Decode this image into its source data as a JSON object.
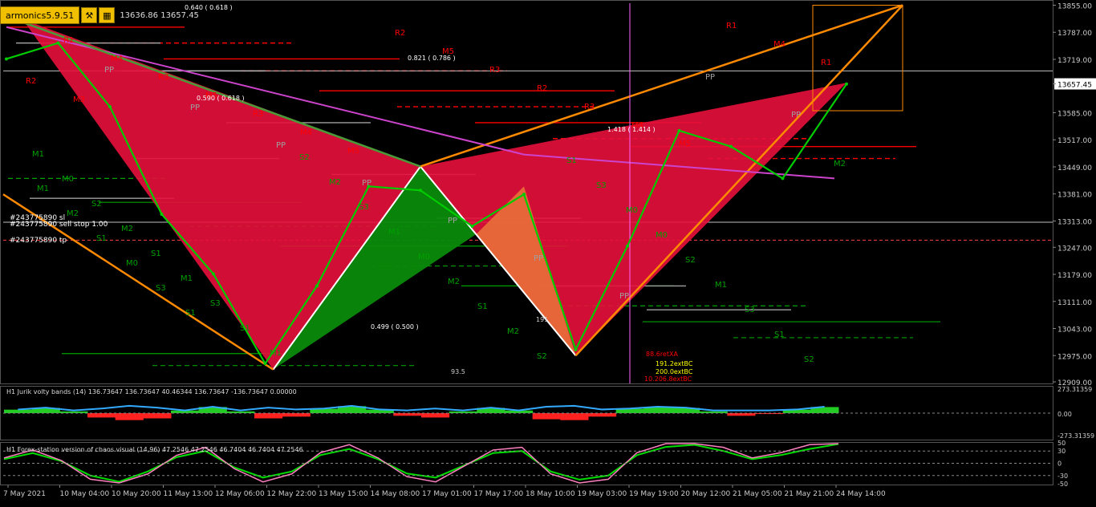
{
  "header": {
    "indicator_title": "armonics5.9.51",
    "ohlc": "13636.86 13657.45"
  },
  "colors": {
    "background": "#000000",
    "candle": "#00cc00",
    "resistance": "#ff0000",
    "support": "#00a000",
    "pivot": "#a0a0a0",
    "harmonic_fill": "#e8103c",
    "orange_trend": "#ff8a00",
    "ma_line": "#cc44cc",
    "jurik_up": "#22cc22",
    "jurik_down": "#ff2020",
    "jurik_band": "#33aaff",
    "chaos_line": "#00dd00",
    "chaos_pink": "#ff80c0",
    "chaos_white": "#e0e0e0"
  },
  "chart_data": [
    {
      "type": "line",
      "title": "",
      "x": [
        "7 May 2021",
        "10 May 04:00",
        "10 May 20:00",
        "11 May 13:00",
        "12 May 06:00",
        "12 May 22:00",
        "13 May 15:00",
        "14 May 08:00",
        "17 May 01:00",
        "17 May 17:00",
        "18 May 10:00",
        "19 May 03:00",
        "19 May 19:00",
        "20 May 12:00",
        "21 May 05:00",
        "21 May 21:00",
        "24 May 14:00"
      ],
      "series": [
        {
          "values": [
            13720,
            13760,
            13600,
            13330,
            13180,
            12955,
            13150,
            13400,
            13390,
            13300,
            13380,
            12990,
            13250,
            13540,
            13500,
            13420,
            13657
          ]
        }
      ],
      "ylim": [
        12905,
        13860
      ],
      "price_ticks": [
        "13855.00",
        "13787.00",
        "13719.00",
        "13657.45",
        "13585.00",
        "13517.00",
        "13449.00",
        "13381.00",
        "13313.00",
        "13247.00",
        "13179.00",
        "13111.00",
        "13043.00",
        "12975.00",
        "12909.00"
      ],
      "current_price": 13657.45,
      "labels": {
        "resistance": [
          "M3",
          "R1",
          "M4",
          "R3",
          "M5",
          "R3",
          "M4",
          "M5",
          "R2",
          "M5",
          "R3",
          "R2",
          "R3",
          "M4",
          "M5",
          "R1",
          "M4",
          "R1",
          "R2",
          "M3"
        ],
        "support": [
          "M1",
          "M0",
          "S2",
          "M2",
          "S1",
          "M1",
          "S3",
          "S1",
          "M1",
          "S2",
          "M2",
          "S3",
          "M1",
          "M0",
          "M2",
          "S1",
          "M2",
          "S2",
          "S1",
          "S3",
          "M0",
          "M0",
          "S2",
          "M1",
          "S3",
          "S1",
          "S2",
          "M2",
          "M1",
          "M2",
          "S1",
          "M0",
          "S3",
          "S1"
        ],
        "pivot": [
          "PP",
          "PP",
          "PP",
          "PP",
          "PP",
          "PP",
          "PP",
          "PP",
          "PP"
        ]
      },
      "ratio_labels": [
        "0.640 ( 0.618 )",
        "0.821 ( 0.786 )",
        "0.590 ( 0.618 )",
        "1.418 ( 1.414 )",
        "0.499 ( 0.500 )"
      ],
      "ext_labels": [
        "88.6retXA",
        "191.2extBC",
        "200.0extBC",
        "10.206.8extBC"
      ],
      "misc_labels": [
        "93.5",
        "191"
      ],
      "order_labels": [
        "#243775890 sl",
        "#243775890 sell stop 1.00",
        "#243775890 tp"
      ]
    },
    {
      "type": "area",
      "title": "H1 Jurik volty bands (14) 136.73647 136.73647 40.46344 136.73647 -136.73647 0.00000",
      "values": [
        40,
        60,
        20,
        -50,
        -80,
        -60,
        30,
        70,
        20,
        -60,
        -40,
        50,
        80,
        40,
        -30,
        -50,
        20,
        60,
        30,
        -70,
        -80,
        -40,
        50,
        70,
        60,
        20,
        -30,
        -10,
        40,
        70
      ],
      "ylim": [
        -273.31359,
        273.31359
      ],
      "ticks": [
        "273.31359",
        "0.00",
        "-273.31359"
      ]
    },
    {
      "type": "line",
      "title": "H1 Forex-station version of chaos visual (14,96) 47.2546 47.2546 46.7404 46.7404 47.2546",
      "values": [
        10,
        25,
        5,
        -30,
        -45,
        -20,
        15,
        30,
        -10,
        -35,
        -20,
        20,
        35,
        10,
        -25,
        -35,
        -5,
        25,
        30,
        -20,
        -40,
        -30,
        20,
        40,
        45,
        30,
        10,
        20,
        35,
        47
      ],
      "ylim": [
        -50,
        50
      ],
      "ticks": [
        "50",
        "30",
        "0",
        "-30",
        "-50"
      ]
    }
  ],
  "time_axis": [
    "7 May 2021",
    "10 May 04:00",
    "10 May 20:00",
    "11 May 13:00",
    "12 May 06:00",
    "12 May 22:00",
    "13 May 15:00",
    "14 May 08:00",
    "17 May 01:00",
    "17 May 17:00",
    "18 May 10:00",
    "19 May 03:00",
    "19 May 19:00",
    "20 May 12:00",
    "21 May 05:00",
    "21 May 21:00",
    "24 May 14:00"
  ]
}
